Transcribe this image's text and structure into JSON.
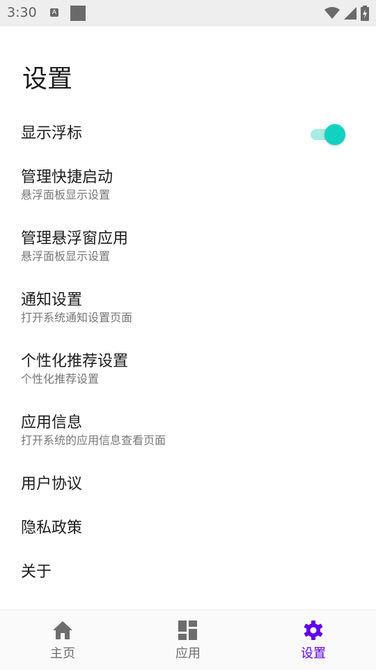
{
  "status_bar": {
    "time": "3:30",
    "notification_icon_letter": "A",
    "icons": [
      "wifi-icon",
      "cell-signal-icon",
      "battery-charging-icon"
    ]
  },
  "page": {
    "title": "设置"
  },
  "settings": {
    "floating_badge": {
      "title": "显示浮标",
      "enabled": true
    },
    "shortcut": {
      "title": "管理快捷启动",
      "subtitle": "悬浮面板显示设置"
    },
    "floating_apps": {
      "title": "管理悬浮窗应用",
      "subtitle": "悬浮面板显示设置"
    },
    "notifications": {
      "title": "通知设置",
      "subtitle": "打开系统通知设置页面"
    },
    "personalized": {
      "title": "个性化推荐设置",
      "subtitle": "个性化推荐设置"
    },
    "app_info": {
      "title": "应用信息",
      "subtitle": "打开系统的应用信息查看页面"
    },
    "user_agreement": {
      "title": "用户协议"
    },
    "privacy_policy": {
      "title": "隐私政策"
    },
    "about": {
      "title": "关于"
    }
  },
  "bottom_nav": {
    "home": {
      "label": "主页",
      "icon": "home-icon"
    },
    "apps": {
      "label": "应用",
      "icon": "dashboard-icon"
    },
    "settings": {
      "label": "设置",
      "icon": "gear-icon",
      "active": true
    }
  },
  "colors": {
    "accent": "#6200ee",
    "toggle_on": "#11d1c0",
    "toggle_track": "#a9ebe2",
    "inactive_nav": "#6d6d6d"
  }
}
